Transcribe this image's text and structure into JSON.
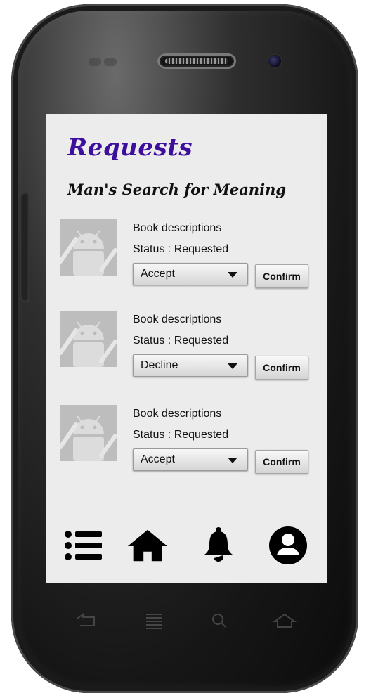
{
  "screen": {
    "title": "Requests",
    "book_title": "Man's Search for Meaning"
  },
  "requests": [
    {
      "description": "Book descriptions",
      "status": "Status : Requested",
      "action": "Accept",
      "confirm_label": "Confirm"
    },
    {
      "description": "Book descriptions",
      "status": "Status : Requested",
      "action": "Decline",
      "confirm_label": "Confirm"
    },
    {
      "description": "Book descriptions",
      "status": "Status : Requested",
      "action": "Accept",
      "confirm_label": "Confirm"
    }
  ],
  "bottom_nav": {
    "items": [
      {
        "icon": "list-icon"
      },
      {
        "icon": "home-icon"
      },
      {
        "icon": "bell-icon"
      },
      {
        "icon": "account-icon"
      }
    ]
  },
  "system_keys": [
    "back-icon",
    "menu-icon",
    "search-icon",
    "home-outline-icon"
  ],
  "colors": {
    "title": "#3d0f9c",
    "screen_bg": "#ececec",
    "icon": "#000000"
  }
}
